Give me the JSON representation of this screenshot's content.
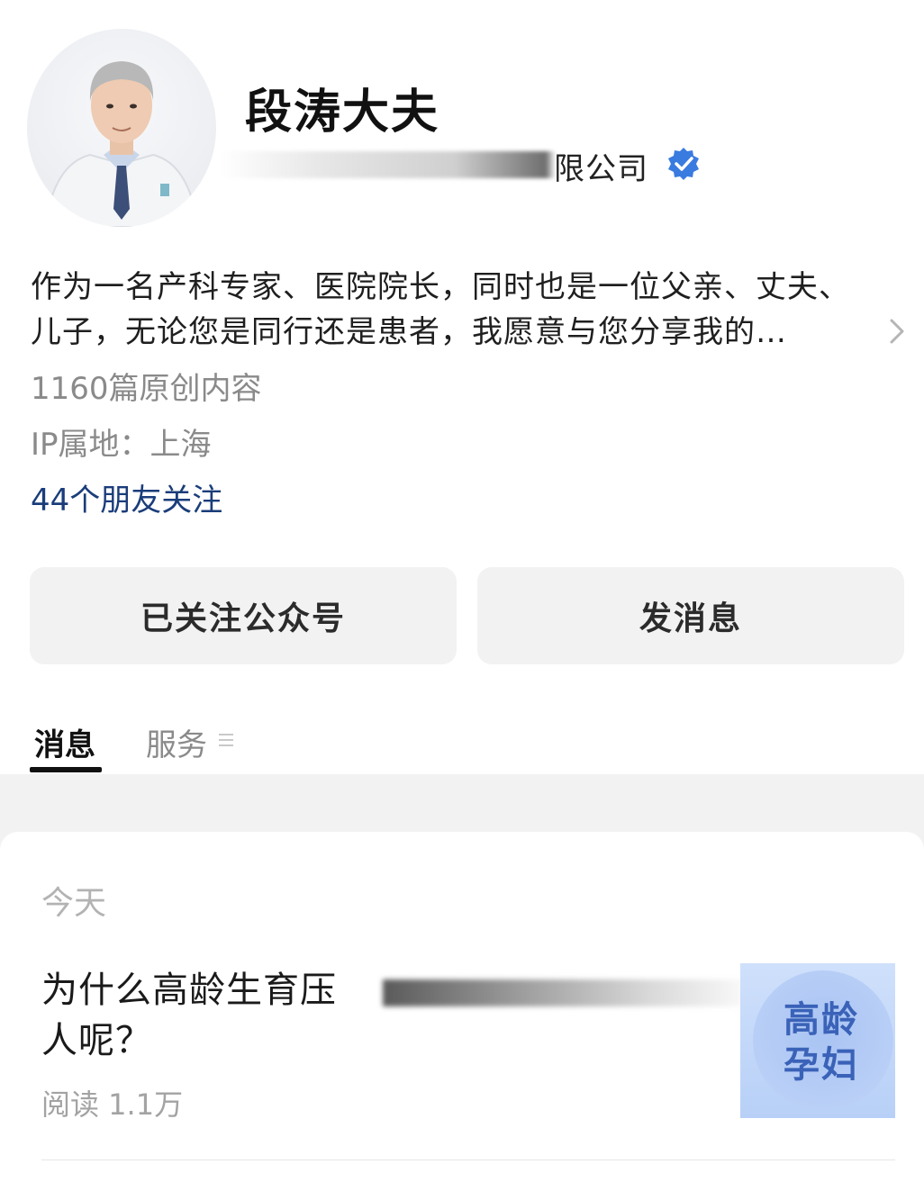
{
  "profile": {
    "name": "段涛大夫",
    "company_suffix": "限公司",
    "verified_icon": "verified-badge-icon",
    "verified_color": "#3a7be0",
    "bio_line1": "作为一名产科专家、医院院长，同时也是一位父亲、丈夫、",
    "bio_line2": "儿子，无论您是同行还是患者，我愿意与您分享我的…",
    "original_count": "1160篇原创内容",
    "ip_location": "IP属地：上海",
    "friends_following": "44个朋友关注"
  },
  "actions": {
    "follow_label": "已关注公众号",
    "message_label": "发消息"
  },
  "tabs": [
    {
      "label": "消息",
      "active": true
    },
    {
      "label": "服务",
      "active": false
    }
  ],
  "feed": {
    "date_label": "今天",
    "articles": [
      {
        "title_line1": "为什么高龄生育压",
        "title_line2": "人呢？",
        "reads": "阅读 1.1万",
        "thumb_line1": "高龄",
        "thumb_line2": "孕妇"
      }
    ]
  },
  "colors": {
    "link": "#1a3d7a",
    "button_bg": "#f2f2f2",
    "muted": "#8a8a8a"
  }
}
